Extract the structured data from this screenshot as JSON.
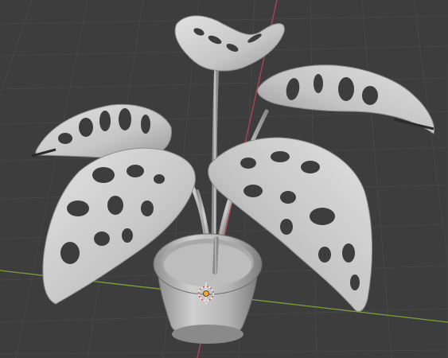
{
  "viewport": {
    "view": "3D Viewport",
    "object": "monstera-plant-in-pot",
    "background_color": "#3d3d3d",
    "grid_color": "#474747",
    "x_axis_color": "#7fa03a",
    "y_axis_color": "#b8424d",
    "object_color": "#c9c9c9",
    "origin_marker_color": "#f2a33a"
  },
  "scene": {
    "leaf_count": 5,
    "origin_gizmo": "object-origin-icon"
  }
}
